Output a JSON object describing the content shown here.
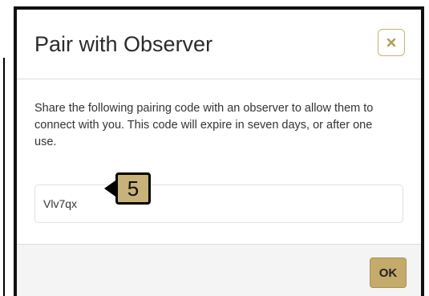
{
  "dialog": {
    "title": "Pair with Observer",
    "description": "Share the following pairing code with an observer to allow them to connect with you. This code will expire in seven days, or after one use.",
    "pairing_code": "Vlv7qx",
    "ok_label": "OK",
    "close_icon": "close-icon"
  },
  "annotation": {
    "step_number": "5"
  },
  "colors": {
    "accent": "#c4ab6c",
    "accent_border": "#a89250",
    "footer_background": "#f4f4f4",
    "callout_background": "#c9b27a"
  }
}
